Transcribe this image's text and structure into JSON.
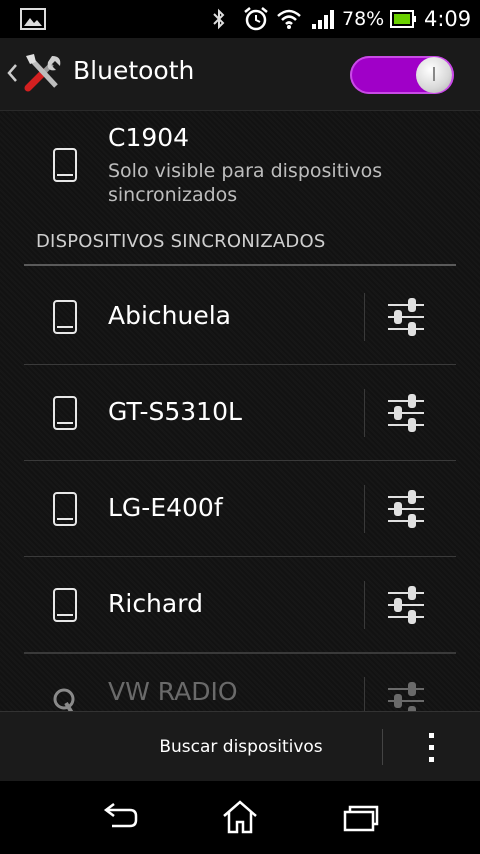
{
  "status_bar": {
    "battery_percent": "78%",
    "time": "4:09",
    "icons": [
      "gallery-notification-icon",
      "bluetooth-icon",
      "alarm-icon",
      "wifi-icon",
      "signal-icon",
      "battery-icon"
    ]
  },
  "action_bar": {
    "title": "Bluetooth",
    "toggle_on": true,
    "accent_color": "#a000c8"
  },
  "own_device": {
    "name": "C1904",
    "visibility": "Solo visible para dispositivos sincronizados"
  },
  "paired_section": {
    "header": "DISPOSITIVOS SINCRONIZADOS",
    "devices": [
      {
        "name": "Abichuela",
        "icon": "phone-icon"
      },
      {
        "name": "GT-S5310L",
        "icon": "phone-icon"
      },
      {
        "name": "LG-E400f",
        "icon": "phone-icon"
      },
      {
        "name": "Richard",
        "icon": "phone-icon"
      },
      {
        "name": "VW RADIO",
        "icon": "headset-icon"
      }
    ]
  },
  "bottom_bar": {
    "scan_label": "Buscar dispositivos"
  },
  "nav_bar": {
    "icons": [
      "back-icon",
      "home-icon",
      "recents-icon"
    ]
  }
}
